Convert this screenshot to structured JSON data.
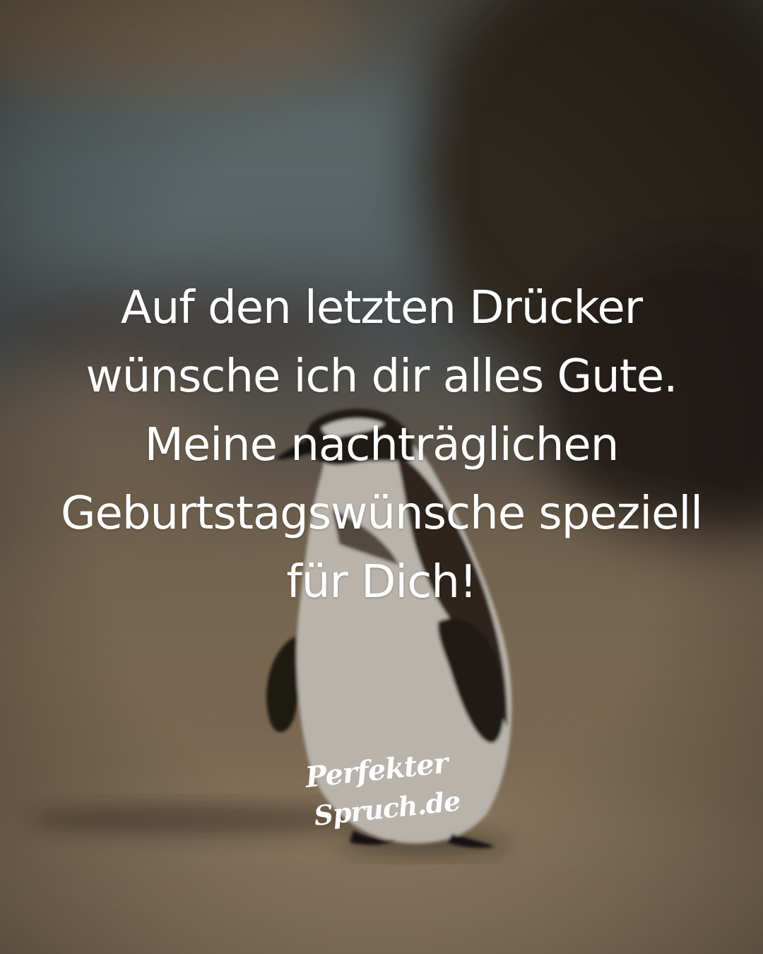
{
  "quote": {
    "lines": [
      "Auf den letzten Drücker",
      "wünsche ich dir alles Gute.",
      "Meine nachträglichen",
      "Geburtstagswünsche speziell",
      "für Dich!"
    ]
  },
  "logo": {
    "line1": "Perfekter",
    "line2": "Spruch.de"
  },
  "background": {
    "subject": "penguin-on-beach",
    "colors": {
      "sky": "#6f7a7c",
      "rock": "#3b3128",
      "sand": "#a58d70",
      "overlay": "#000000"
    }
  }
}
